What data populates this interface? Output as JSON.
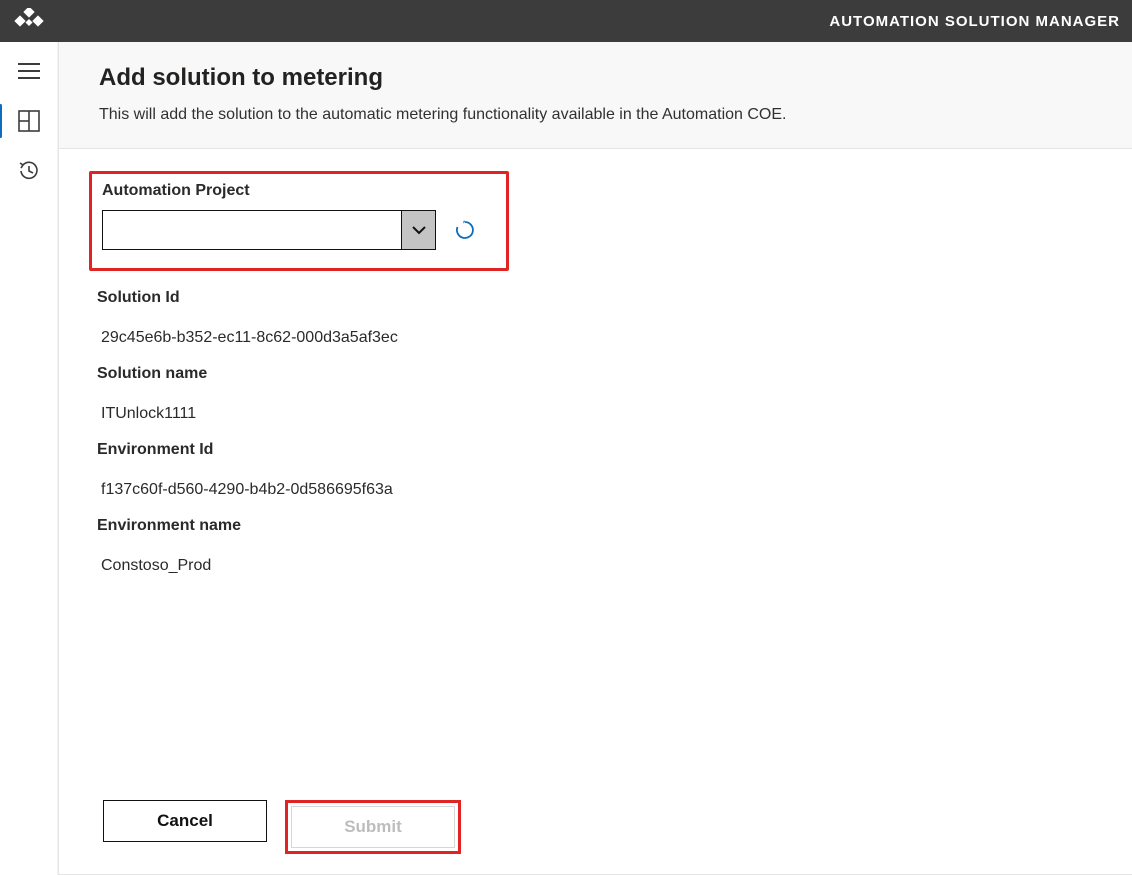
{
  "header": {
    "title": "AUTOMATION SOLUTION MANAGER"
  },
  "page": {
    "title": "Add solution to metering",
    "description": "This will add the solution to the automatic metering functionality available in the Automation COE."
  },
  "form": {
    "automation_project": {
      "label": "Automation Project",
      "value": ""
    },
    "solution_id": {
      "label": "Solution Id",
      "value": "29c45e6b-b352-ec11-8c62-000d3a5af3ec"
    },
    "solution_name": {
      "label": "Solution name",
      "value": "ITUnlock1111"
    },
    "environment_id": {
      "label": "Environment Id",
      "value": "f137c60f-d560-4290-b4b2-0d586695f63a"
    },
    "environment_name": {
      "label": "Environment name",
      "value": "Constoso_Prod"
    }
  },
  "actions": {
    "cancel": "Cancel",
    "submit": "Submit"
  }
}
